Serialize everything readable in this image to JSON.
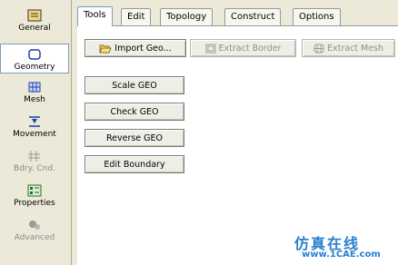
{
  "sidebar": {
    "items": [
      {
        "label": "General",
        "icon": "general-icon",
        "active": false
      },
      {
        "label": "Geometry",
        "icon": "geometry-icon",
        "active": true
      },
      {
        "label": "Mesh",
        "icon": "mesh-icon",
        "active": false
      },
      {
        "label": "Movement",
        "icon": "movement-icon",
        "active": false
      },
      {
        "label": "Bdry. Cnd.",
        "icon": "boundary-condition-icon",
        "active": false,
        "disabled": true
      },
      {
        "label": "Properties",
        "icon": "properties-icon",
        "active": false
      },
      {
        "label": "Advanced",
        "icon": "advanced-icon",
        "active": false,
        "disabled": true
      }
    ]
  },
  "tabs": [
    {
      "label": "Tools",
      "active": true
    },
    {
      "label": "Edit"
    },
    {
      "label": "Topology"
    },
    {
      "label": "Construct"
    },
    {
      "label": "Options"
    }
  ],
  "toolbar": {
    "import_geo": "Import Geo...",
    "extract_border": "Extract Border",
    "extract_mesh": "Extract Mesh"
  },
  "actions": {
    "scale_geo": "Scale GEO",
    "check_geo": "Check GEO",
    "reverse_geo": "Reverse GEO",
    "edit_boundary": "Edit  Boundary"
  },
  "watermark": {
    "cn": "仿真在线",
    "url": "www.1CAE.com"
  },
  "colors": {
    "accent": "#2a7fd0",
    "panel": "#ece9d8"
  }
}
